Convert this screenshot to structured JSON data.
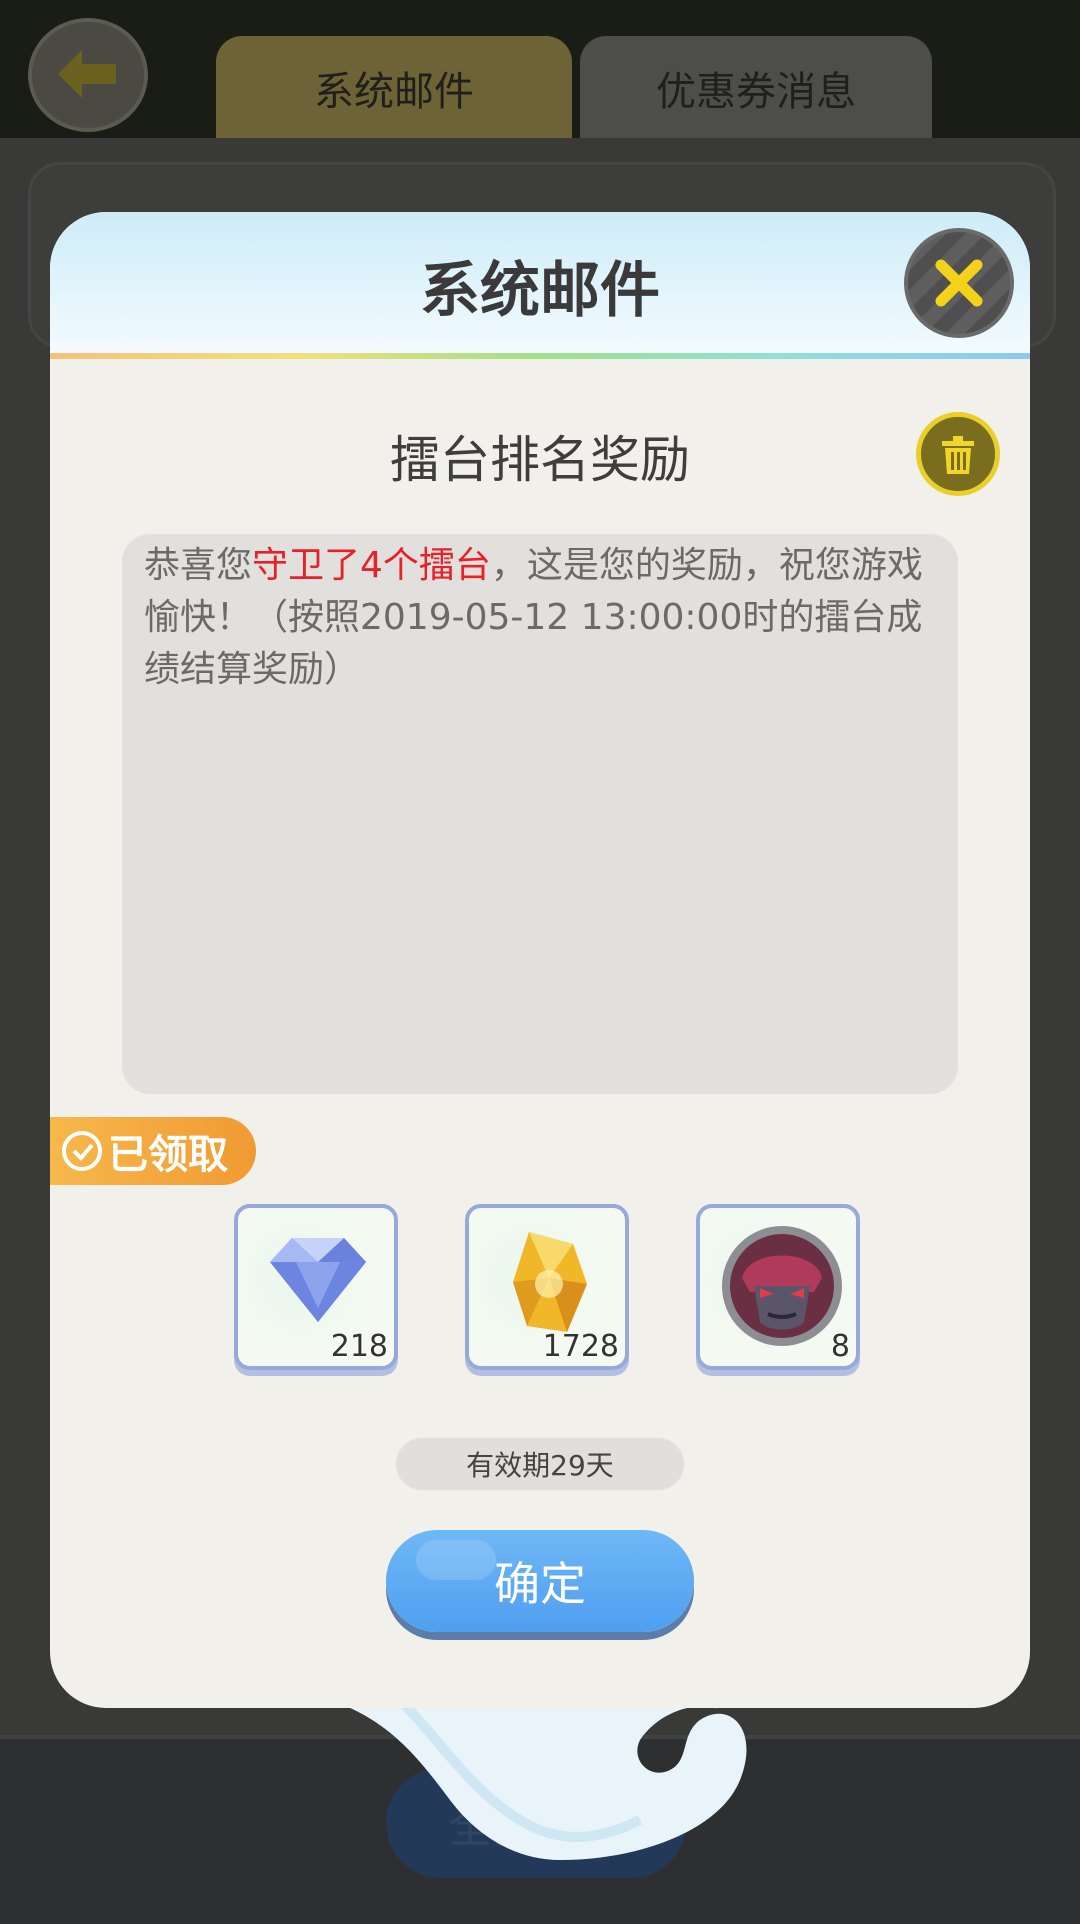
{
  "tabs": [
    {
      "label": "系统邮件"
    },
    {
      "label": "优惠券消息"
    }
  ],
  "background_button": {
    "label": "全部领取"
  },
  "dialog": {
    "title": "系统邮件",
    "mail_title": "擂台排名奖励",
    "content": {
      "prefix": "恭喜您",
      "highlight": "守卫了4个擂台",
      "rest": "，这是您的奖励，祝您游戏愉快！（按照2019-05-12 13:00:00时的擂台成绩结算奖励）",
      "highlight_color": "#e8202a"
    },
    "claimed_label": "已领取",
    "rewards": [
      {
        "icon": "diamond-icon",
        "count": "218"
      },
      {
        "icon": "gold-crystal-icon",
        "count": "1728"
      },
      {
        "icon": "monster-badge-icon",
        "count": "8"
      }
    ],
    "validity": "有效期29天",
    "confirm_label": "确定"
  },
  "colors": {
    "accent_blue": "#5aa8f3",
    "claimed_orange": "#f4a83f",
    "close_yellow": "#f5d21a"
  }
}
